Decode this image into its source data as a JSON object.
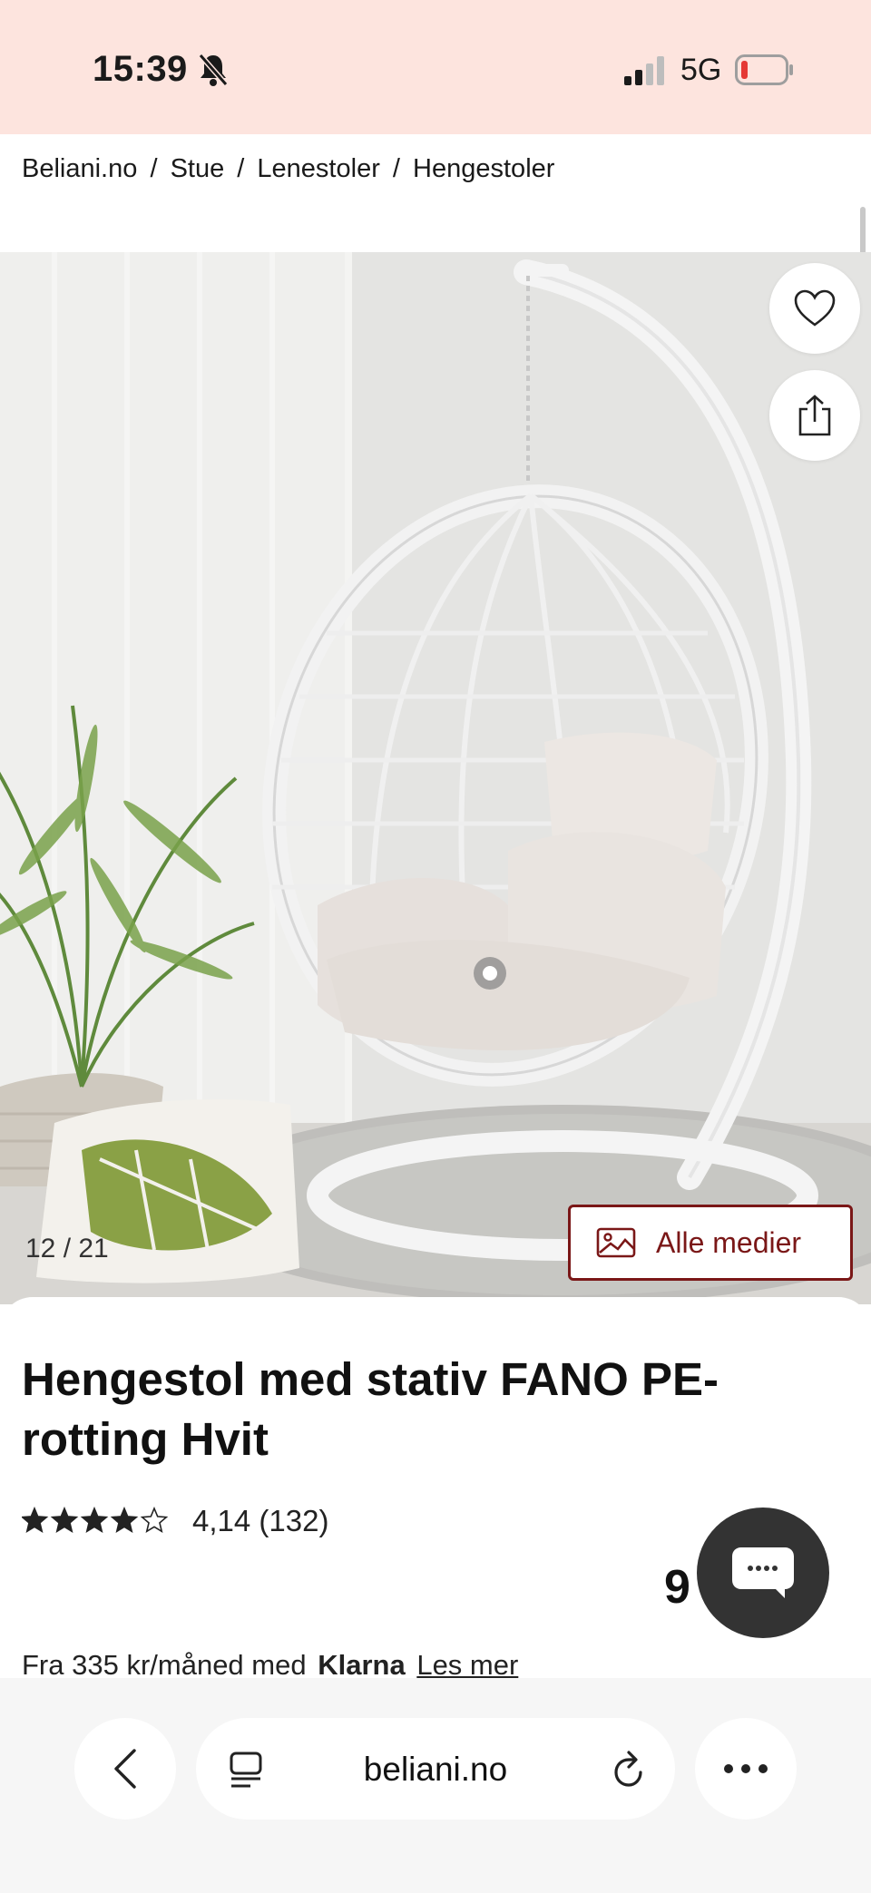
{
  "status_bar": {
    "time": "15:39",
    "network": "5G",
    "icons": [
      "bell-slash-icon",
      "signal-icon",
      "battery-icon"
    ],
    "battery_color": "#e53935"
  },
  "breadcrumb": {
    "items": [
      "Beliani.no",
      "Stue",
      "Lenestoler",
      "Hengestoler"
    ],
    "separator": "/"
  },
  "gallery": {
    "counter": "12 / 21",
    "media_button_label": "Alle medier",
    "favorite_icon": "heart-icon",
    "share_icon": "share-icon"
  },
  "product": {
    "title": "Hengestol med stativ FANO PE-rotting Hvit",
    "rating_value": 4.14,
    "rating_max": 5,
    "rating_text": "4,14 (132)",
    "price_visible": "9",
    "price_suffix": "-",
    "klarna": {
      "prefix": "Fra 335 kr/måned med",
      "brand": "Klarna",
      "link": "Les mer"
    }
  },
  "browser": {
    "address": "beliani.no",
    "buttons": [
      "back-icon",
      "reader-icon",
      "reload-icon",
      "more-icon"
    ]
  },
  "colors": {
    "status_bg": "#fde4de",
    "brand_red": "#7a1717",
    "chat_bg": "#333333"
  }
}
